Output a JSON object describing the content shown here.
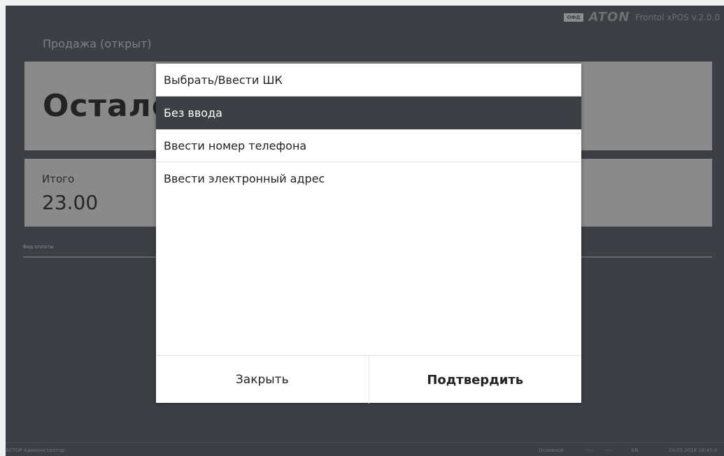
{
  "header": {
    "ofd_badge": "ОФД",
    "brand": "ATON",
    "version": "Frontol xPOS v.2.0.0"
  },
  "page": {
    "title": "Продажа (открыт)"
  },
  "remain": {
    "label": "Осталось"
  },
  "total": {
    "label": "Итого",
    "value": "23.00"
  },
  "payment": {
    "label": "Вид оплаты"
  },
  "dialog": {
    "options": [
      {
        "label": "Выбрать/Ввести ШК",
        "selected": false
      },
      {
        "label": "Без ввода",
        "selected": true
      },
      {
        "label": "Ввести номер телефона",
        "selected": false
      },
      {
        "label": "Ввести электронный адрес",
        "selected": false
      }
    ],
    "close_label": "Закрыть",
    "confirm_label": "Подтвердить"
  },
  "statusbar": {
    "user": "АСТОР  Администратор",
    "mode": "Основной",
    "time1": "--:--",
    "time2": "--:--",
    "lang": "EN",
    "datetime": "24.03.2018 18:45:0"
  },
  "colors": {
    "background": "#3c3f44",
    "panel": "#8a8a8a",
    "selected": "#3c3f44",
    "dialog": "#ffffff"
  }
}
